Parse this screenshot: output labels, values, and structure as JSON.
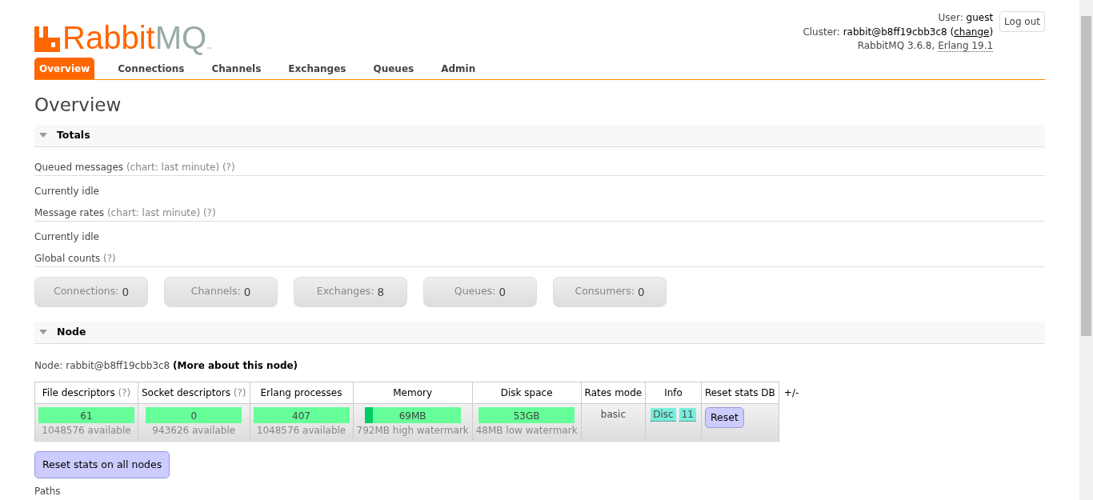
{
  "logo": {
    "part1": "Rabbit",
    "part2": "MQ",
    "mark": "™"
  },
  "header": {
    "user_label": "User:",
    "user": "guest",
    "cluster_label": "Cluster:",
    "cluster": "rabbit@b8ff19cbb3c8",
    "paren_open": "(",
    "change_link": "change",
    "paren_close": ")",
    "version": "RabbitMQ 3.6.8,",
    "erlang": "Erlang 19.1",
    "logout": "Log out"
  },
  "tabs": [
    {
      "label": "Overview",
      "selected": true
    },
    {
      "label": "Connections",
      "selected": false
    },
    {
      "label": "Channels",
      "selected": false
    },
    {
      "label": "Exchanges",
      "selected": false
    },
    {
      "label": "Queues",
      "selected": false
    },
    {
      "label": "Admin",
      "selected": false
    }
  ],
  "title": "Overview",
  "totals": {
    "title": "Totals",
    "expanded": true,
    "rows": [
      {
        "kind": "heading",
        "label": "Queued messages",
        "note": "(chart: last minute)",
        "help": "(?)"
      },
      {
        "kind": "text",
        "label": "Currently idle"
      },
      {
        "kind": "heading",
        "label": "Message rates",
        "note": "(chart: last minute)",
        "help": "(?)"
      },
      {
        "kind": "text",
        "label": "Currently idle"
      },
      {
        "kind": "heading",
        "label": "Global counts",
        "help": "(?)"
      }
    ],
    "counts": [
      {
        "label": "Connections:",
        "value": "0"
      },
      {
        "label": "Channels:",
        "value": "0"
      },
      {
        "label": "Exchanges:",
        "value": "8"
      },
      {
        "label": "Queues:",
        "value": "0"
      },
      {
        "label": "Consumers:",
        "value": "0"
      }
    ]
  },
  "node": {
    "title": "Node",
    "expanded": true,
    "node_label": "Node:",
    "node_name": "rabbit@b8ff19cbb3c8",
    "more_link": "(More about this node)",
    "columns": [
      {
        "label": "File descriptors",
        "help": "(?)"
      },
      {
        "label": "Socket descriptors",
        "help": "(?)"
      },
      {
        "label": "Erlang processes"
      },
      {
        "label": "Memory"
      },
      {
        "label": "Disk space"
      },
      {
        "label": "Rates mode"
      },
      {
        "label": "Info"
      },
      {
        "label": "Reset stats DB"
      }
    ],
    "toggle": "+/-",
    "meters": [
      {
        "value": "61",
        "level": 0,
        "sub": "1048576 available"
      },
      {
        "value": "0",
        "level": 0,
        "sub": "943626 available"
      },
      {
        "value": "407",
        "level": 0,
        "sub": "1048576 available"
      },
      {
        "value": "69MB",
        "level": 0.09,
        "sub": "792MB high watermark"
      },
      {
        "value": "53GB",
        "level": 0,
        "sub": "48MB low watermark"
      }
    ],
    "rates_mode": "basic",
    "info_tags": [
      "Disc",
      "11"
    ],
    "reset_button": "Reset"
  },
  "reset_all_button": "Reset stats on all nodes",
  "paths_label": "Paths"
}
